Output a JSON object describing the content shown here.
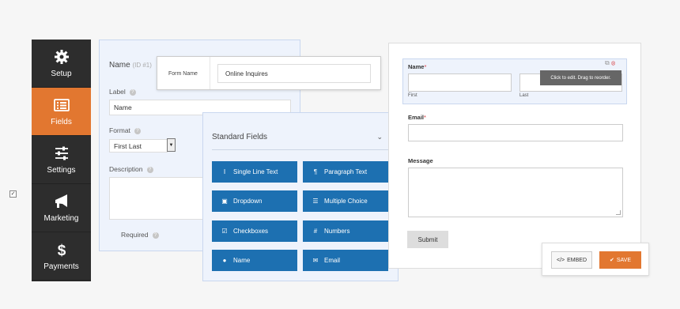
{
  "sidebar": {
    "items": [
      {
        "label": "Setup",
        "icon": "gear-icon"
      },
      {
        "label": "Fields",
        "icon": "list-icon",
        "active": true
      },
      {
        "label": "Settings",
        "icon": "sliders-icon"
      },
      {
        "label": "Marketing",
        "icon": "megaphone-icon"
      },
      {
        "label": "Payments",
        "icon": "dollar-icon"
      }
    ]
  },
  "field_options": {
    "title": "Name",
    "id_text": "(ID #1)",
    "label_label": "Label",
    "label_value": "Name",
    "format_label": "Format",
    "format_value": "First Last",
    "description_label": "Description",
    "required_label": "Required",
    "required_checked": true
  },
  "form_name": {
    "label": "Form Name",
    "value": "Online Inquires"
  },
  "standard_fields": {
    "title": "Standard Fields",
    "buttons": [
      {
        "label": "Single Line Text",
        "icon": "text-cursor-icon"
      },
      {
        "label": "Paragraph Text",
        "icon": "paragraph-icon"
      },
      {
        "label": "Dropdown",
        "icon": "dropdown-icon"
      },
      {
        "label": "Multiple Choice",
        "icon": "list-icon"
      },
      {
        "label": "Checkboxes",
        "icon": "checkbox-icon"
      },
      {
        "label": "Numbers",
        "icon": "hash-icon"
      },
      {
        "label": "Name",
        "icon": "user-icon"
      },
      {
        "label": "Email",
        "icon": "envelope-icon"
      }
    ]
  },
  "preview": {
    "name_label": "Name",
    "first_label": "First",
    "last_label": "Last",
    "tooltip": "Click to edit. Drag to reorder.",
    "email_label": "Email",
    "message_label": "Message",
    "submit_label": "Submit",
    "required_mark": "*"
  },
  "toolbar": {
    "embed_label": "EMBED",
    "save_label": "SAVE"
  },
  "colors": {
    "accent": "#e27730",
    "button_blue": "#1d70b1",
    "sidebar": "#2d2d2d",
    "panel": "#eef3fc"
  }
}
